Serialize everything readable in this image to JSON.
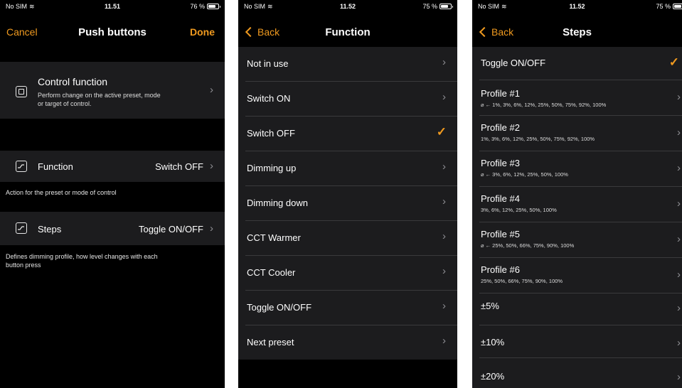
{
  "screen1": {
    "status": {
      "carrier": "No SIM",
      "time": "11.51",
      "battery": "76 %",
      "battery_level": 0.76
    },
    "nav": {
      "left": "Cancel",
      "title": "Push buttons",
      "right": "Done"
    },
    "control": {
      "title": "Control function",
      "desc_line1": "Perform change on the active preset, mode",
      "desc_line2": "or target of control."
    },
    "function_row": {
      "label": "Function",
      "value": "Switch OFF"
    },
    "function_note": "Action for the preset or mode of control",
    "steps_row": {
      "label": "Steps",
      "value": "Toggle ON/OFF"
    },
    "steps_note_line1": "Defines dimming profile, how level changes with each",
    "steps_note_line2": "button press"
  },
  "screen2": {
    "status": {
      "carrier": "No SIM",
      "time": "11.52",
      "battery": "75 %",
      "battery_level": 0.75
    },
    "nav": {
      "back": "Back",
      "title": "Function"
    },
    "items": [
      {
        "label": "Not in use"
      },
      {
        "label": "Switch ON"
      },
      {
        "label": "Switch OFF",
        "selected": true
      },
      {
        "label": "Dimming up"
      },
      {
        "label": "Dimming down"
      },
      {
        "label": "CCT Warmer"
      },
      {
        "label": "CCT Cooler"
      },
      {
        "label": "Toggle ON/OFF"
      },
      {
        "label": "Next preset"
      }
    ]
  },
  "screen3": {
    "status": {
      "carrier": "No SIM",
      "time": "11.52",
      "battery": "75 %",
      "battery_level": 0.75
    },
    "nav": {
      "back": "Back",
      "title": "Steps"
    },
    "toggle": {
      "label": "Toggle ON/OFF",
      "selected": true
    },
    "profiles": [
      {
        "title": "Profile #1",
        "sub": "⌀ ← 1%, 3%, 6%, 12%, 25%, 50%, 75%, 92%, 100%"
      },
      {
        "title": "Profile #2",
        "sub": "1%, 3%, 6%, 12%, 25%, 50%, 75%, 92%, 100%"
      },
      {
        "title": "Profile #3",
        "sub": "⌀ ← 3%, 6%, 12%, 25%, 50%, 100%"
      },
      {
        "title": "Profile #4",
        "sub": "3%, 6%, 12%, 25%, 50%, 100%"
      },
      {
        "title": "Profile #5",
        "sub": "⌀ ← 25%, 50%, 66%, 75%, 90%, 100%"
      },
      {
        "title": "Profile #6",
        "sub": "25%, 50%, 66%, 75%, 90%, 100%"
      }
    ],
    "plusminus": [
      {
        "label": "±5%"
      },
      {
        "label": "±10%"
      },
      {
        "label": "±20%"
      }
    ]
  },
  "icons": {
    "chevron": "chevron-right-icon",
    "check": "checkmark-icon",
    "wifi": "wifi-icon",
    "battery": "battery-icon"
  },
  "colors": {
    "accent": "#f09a1f",
    "cell": "#1c1c1e",
    "background": "#000000"
  }
}
